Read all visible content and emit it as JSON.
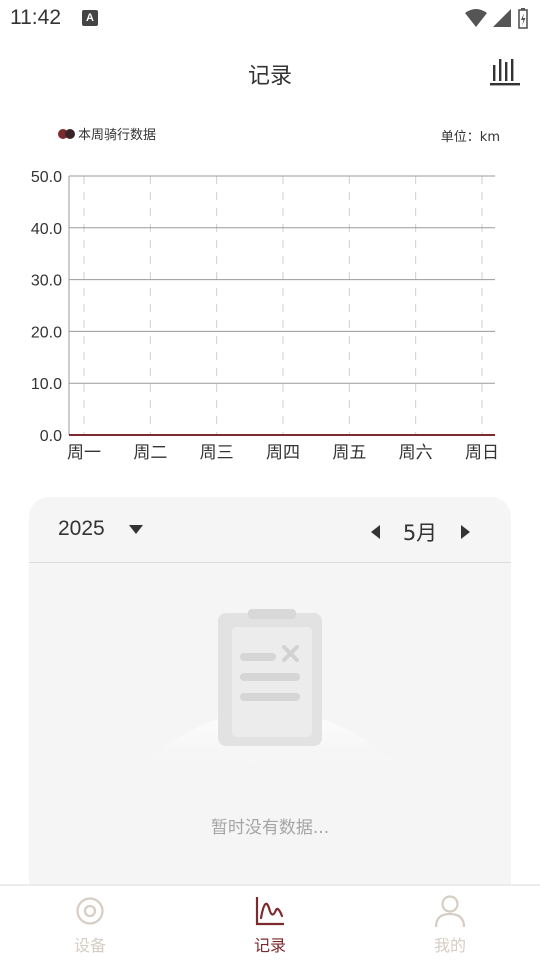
{
  "status_bar": {
    "time": "11:42",
    "notification_badge": "A"
  },
  "header": {
    "title": "记录",
    "stats_icon": "bar-chart-icon"
  },
  "chart_data": {
    "type": "line",
    "title": "",
    "legend": "本周骑行数据",
    "unit_label": "单位：km",
    "categories": [
      "周一",
      "周二",
      "周三",
      "周四",
      "周五",
      "周六",
      "周日"
    ],
    "series": [
      {
        "name": "本周骑行数据",
        "values": [
          0,
          0,
          0,
          0,
          0,
          0,
          0
        ]
      }
    ],
    "ylim": [
      0,
      50
    ],
    "yticks": [
      "0.0",
      "10.0",
      "20.0",
      "30.0",
      "40.0",
      "50.0"
    ],
    "grid": true,
    "colors": {
      "series": "#7d2a2e",
      "grid": "#9a9a9a",
      "vgrid": "#cfcfcf"
    }
  },
  "calendar": {
    "year": "2025",
    "month": "5月",
    "empty_text": "暂时没有数据..."
  },
  "bottom_nav": {
    "items": [
      {
        "label": "设备",
        "icon": "device-ring-icon",
        "active": false
      },
      {
        "label": "记录",
        "icon": "line-chart-icon",
        "active": true
      },
      {
        "label": "我的",
        "icon": "user-icon",
        "active": false
      }
    ]
  },
  "colors": {
    "accent": "#7d2a2e",
    "inactive": "#d6cdc4",
    "card_bg": "#f5f5f5"
  }
}
